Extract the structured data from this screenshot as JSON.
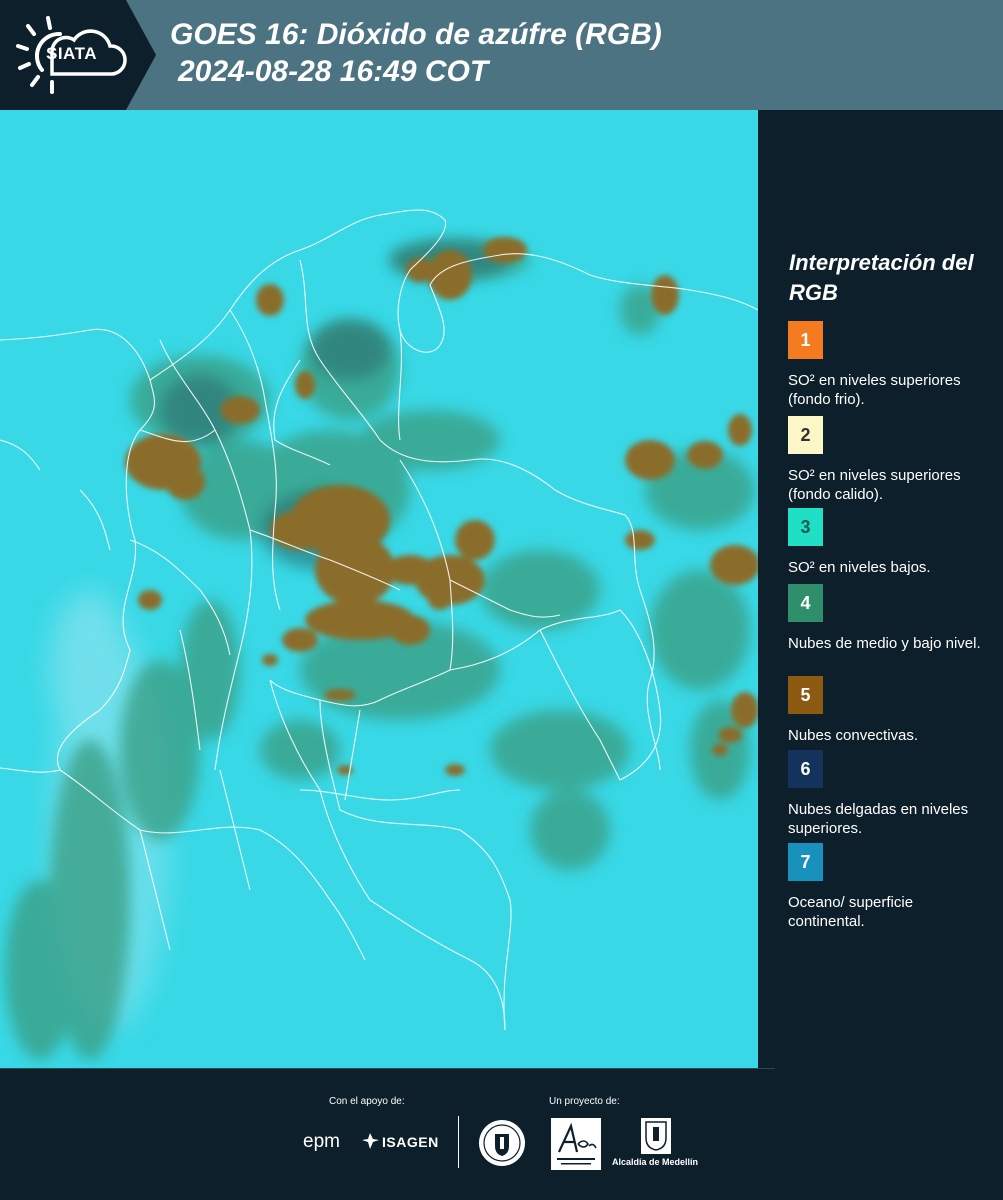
{
  "header": {
    "logo_text": "SIATA",
    "title_line1": "GOES 16: Dióxido de azúfre (RGB)",
    "title_line2": "2024-08-28 16:49 COT"
  },
  "map": {
    "background_color": "#38d8e6",
    "cloud_color": "#8a6d2a",
    "border_color": "#ffffff"
  },
  "legend": {
    "title": "Interpretación del RGB",
    "items": [
      {
        "number": "1",
        "color": "#f47b20",
        "text": "SO² en niveles superiores (fondo frio)."
      },
      {
        "number": "2",
        "color": "#fdf6c7",
        "text": "SO² en niveles superiores (fondo calido)."
      },
      {
        "number": "3",
        "color": "#1fe0c4",
        "text": "SO² en niveles bajos."
      },
      {
        "number": "4",
        "color": "#2f8f6a",
        "text": "Nubes de medio y bajo nivel."
      },
      {
        "number": "5",
        "color": "#8d5a12",
        "text": "Nubes convectivas."
      },
      {
        "number": "6",
        "color": "#14335c",
        "text": "Nubes delgadas en niveles superiores."
      },
      {
        "number": "7",
        "color": "#1891bd",
        "text": "Oceano/ superficie continental."
      }
    ]
  },
  "footer": {
    "support_label": "Con el apoyo de:",
    "project_label": "Un proyecto de:",
    "sponsors": [
      "epm",
      "ISAGEN"
    ],
    "partner_label": "Alcaldía de Medellín"
  }
}
